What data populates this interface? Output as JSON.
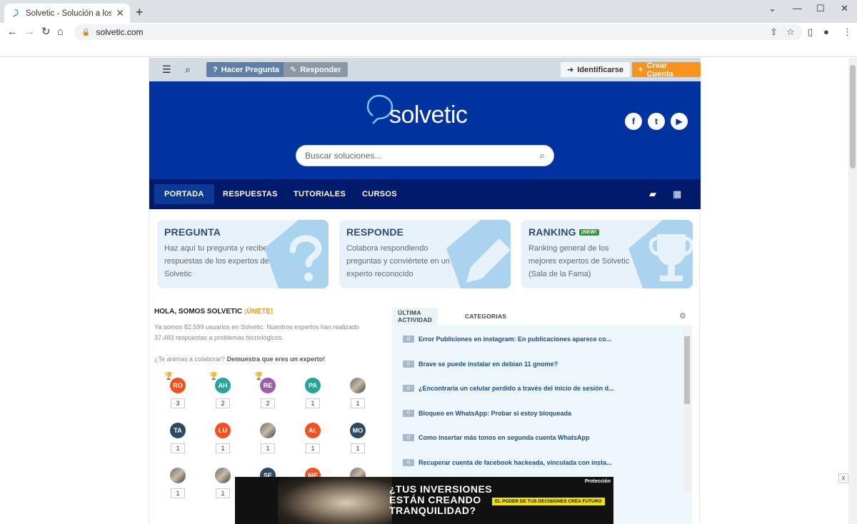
{
  "browser": {
    "tab_title": "Solvetic - Solución a los problemas",
    "tab_close": "✕",
    "new_tab": "+",
    "url": "solvetic.com",
    "win_min": "—",
    "win_max": "☐",
    "win_close": "✕",
    "win_menu": "⌄"
  },
  "sitebar": {
    "ask_label": "Hacer Pregunta",
    "answer_label": "Responder",
    "login_label": "Identificarse",
    "signup_label": "Crear Cuenta"
  },
  "hero": {
    "logo_text": "solvetic",
    "search_placeholder": "Buscar soluciones...",
    "social": [
      "f",
      "t",
      "▶"
    ]
  },
  "nav": {
    "items": [
      "PORTADA",
      "RESPUESTAS",
      "TUTORIALES",
      "CURSOS"
    ]
  },
  "cards": [
    {
      "title": "PREGUNTA",
      "text": "Haz aquí tu pregunta y recibe respuestas de los expertos de Solvetic"
    },
    {
      "title": "RESPONDE",
      "text": "Colabora respondiendo preguntas y conviértete en un experto reconocido"
    },
    {
      "title": "RANKING",
      "badge": "¡NEW!",
      "text": "Ranking general de los mejores expertos de Solvetic (Sala de la Fama)"
    }
  ],
  "community": {
    "heading": "HOLA, SOMOS SOLVETIC",
    "join": "¡ÚNETE!",
    "intro": "Ya somos 82.599 usuarios en Solvetic. Nuestros expertos han realizado 37.483 respuestas a problemas tecnológicos.",
    "cta_prefix": "¿Te animas a colaborar?",
    "cta_bold": "Demuestra que eres un experto!",
    "users": [
      {
        "initials": "RO",
        "color": "#f4511e",
        "count": "3",
        "trophy": "🏆",
        "trophy_color": "#e6a100"
      },
      {
        "initials": "AH",
        "color": "#26a69a",
        "count": "2",
        "trophy": "🏆",
        "trophy_color": "#9e9e9e"
      },
      {
        "initials": "RE",
        "color": "#9c5fa6",
        "count": "2",
        "trophy": "🏆",
        "trophy_color": "#c66a1f"
      },
      {
        "initials": "PA",
        "color": "#26a69a",
        "count": "1"
      },
      {
        "initials": "",
        "photo": true,
        "count": "1"
      },
      {
        "initials": "TA",
        "color": "#2c4a63",
        "count": "1"
      },
      {
        "initials": "LU",
        "color": "#f4511e",
        "count": "1"
      },
      {
        "initials": "",
        "photo": true,
        "count": "1"
      },
      {
        "initials": "AL",
        "color": "#f4511e",
        "count": "1"
      },
      {
        "initials": "MO",
        "color": "#2c4a63",
        "count": "1"
      },
      {
        "initials": "",
        "photo": true,
        "count": "1"
      },
      {
        "initials": "",
        "photo": true,
        "count": "1"
      },
      {
        "initials": "SE",
        "color": "#2c4a63",
        "count": ""
      },
      {
        "initials": "ME",
        "color": "#f4511e",
        "count": ""
      },
      {
        "initials": "",
        "photo": true,
        "count": ""
      }
    ]
  },
  "activity": {
    "tab_active": "ÚLTIMA ACTIVIDAD",
    "tab_other": "CATEGORIAS",
    "items": [
      {
        "count": "0",
        "text": "Error Publiciones en instagram: En publicaciones aparece co..."
      },
      {
        "count": "0",
        "text": "Brave se puede instalar en debian 11 gnome?"
      },
      {
        "count": "0",
        "text": "¿Encontraría un celular perdido a través del inicio de sesión d..."
      },
      {
        "count": "0",
        "text": "Bloqueo en WhatsApp: Probar si estoy bloqueada"
      },
      {
        "count": "0",
        "text": "Como insertar más tonos en segunda cuenta WhatsApp"
      },
      {
        "count": "0",
        "text": "Recuperar cuenta de facebook hackeada, vinculada con insta..."
      }
    ]
  },
  "ad": {
    "headline_1": "¿TUS INVERSIONES",
    "headline_2": "ESTÁN CREANDO",
    "headline_3": "TRANQUILIDAD?",
    "tagline": "EL PODER DE TUS DECISIONES CREA FUTURO",
    "brand": "Protección",
    "close": "X"
  },
  "colors": {
    "hero_bg": "#0032a0",
    "nav_bg": "#001a6b",
    "signup": "#f7931e",
    "ask": "#5f7fa8"
  }
}
